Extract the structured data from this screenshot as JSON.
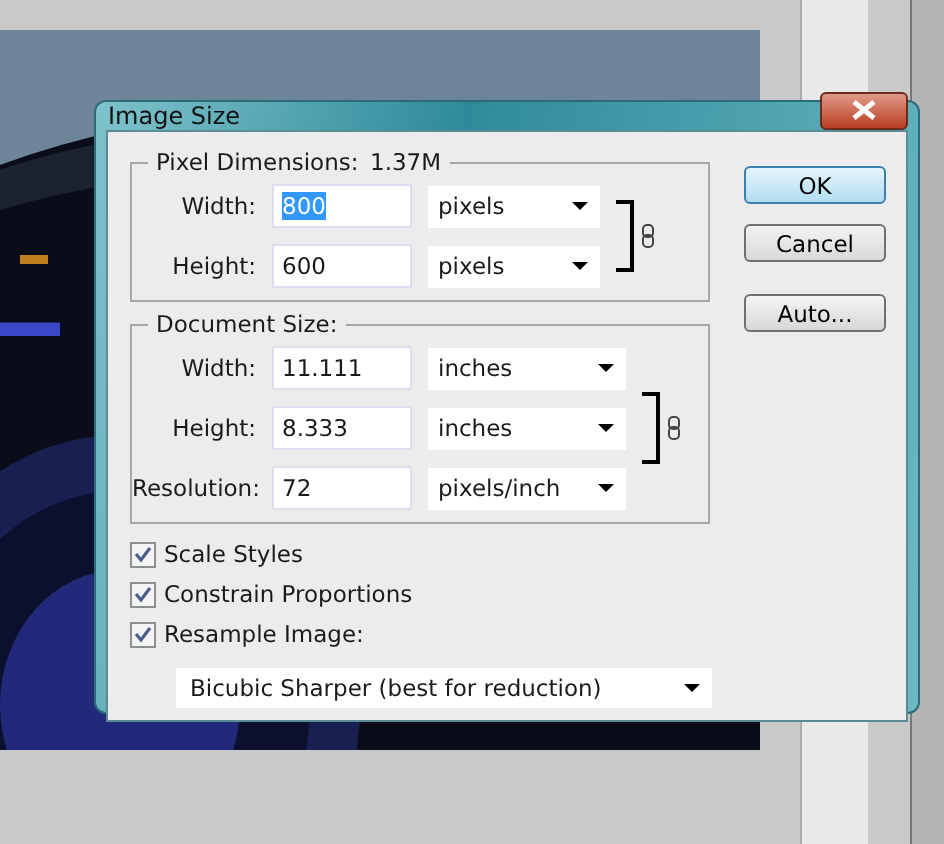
{
  "window": {
    "title": "Image Size"
  },
  "pixel_dimensions": {
    "label": "Pixel Dimensions:",
    "value": "1.37M",
    "linked": true,
    "fields": [
      {
        "label": "Width:",
        "value": "800",
        "unit": "pixels",
        "selected": true
      },
      {
        "label": "Height:",
        "value": "600",
        "unit": "pixels",
        "selected": false
      }
    ]
  },
  "document_size": {
    "label": "Document Size:",
    "linked": true,
    "fields": [
      {
        "label": "Width:",
        "value": "11.111",
        "unit": "inches",
        "selected": false
      },
      {
        "label": "Height:",
        "value": "8.333",
        "unit": "inches",
        "selected": false
      },
      {
        "label": "Resolution:",
        "value": "72",
        "unit": "pixels/inch",
        "selected": false
      }
    ]
  },
  "buttons": [
    {
      "label": "OK",
      "default": true
    },
    {
      "label": "Cancel",
      "default": false
    },
    {
      "label": "Auto...",
      "default": false
    }
  ],
  "options": [
    {
      "label": "Scale Styles",
      "checked": true
    },
    {
      "label": "Constrain Proportions",
      "checked": true
    },
    {
      "label": "Resample Image:",
      "checked": true
    }
  ],
  "resample_method": "Bicubic Sharper (best for reduction)"
}
